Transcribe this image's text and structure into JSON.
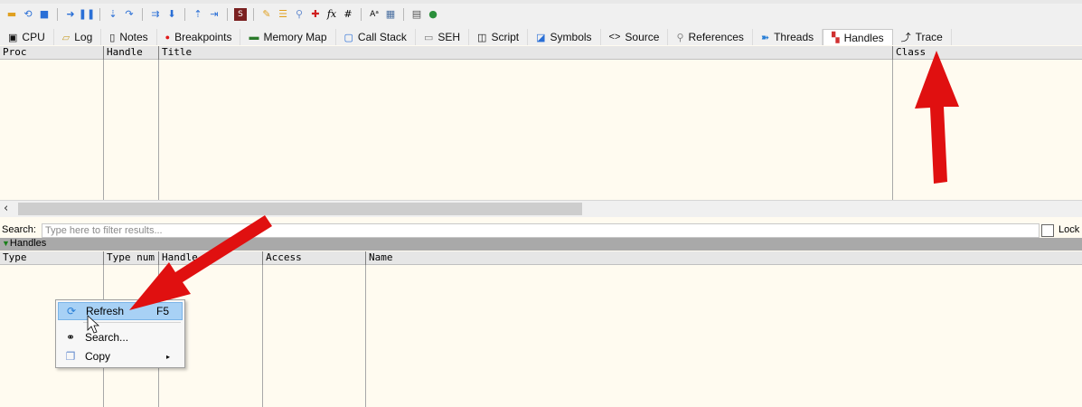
{
  "toolbar": {
    "icons": [
      "open-icon",
      "restart-icon",
      "stop-icon",
      "run-icon",
      "pause-icon",
      "step-into-icon",
      "step-over-icon",
      "trace-into-icon",
      "trace-over-icon",
      "execute-till-return-icon",
      "run-to-user-code-icon",
      "scylla-icon",
      "patch-icon",
      "comment-icon",
      "label-icon",
      "bookmark-icon",
      "function-icon",
      "hash-icon",
      "font-icon",
      "calculator-icon",
      "settings-icon",
      "globe-icon"
    ]
  },
  "tabs": [
    {
      "label": "CPU",
      "icon": "cpu-icon"
    },
    {
      "label": "Log",
      "icon": "log-icon"
    },
    {
      "label": "Notes",
      "icon": "notes-icon"
    },
    {
      "label": "Breakpoints",
      "icon": "breakpoint-dot-icon"
    },
    {
      "label": "Memory Map",
      "icon": "memory-map-icon"
    },
    {
      "label": "Call Stack",
      "icon": "call-stack-icon"
    },
    {
      "label": "SEH",
      "icon": "seh-icon"
    },
    {
      "label": "Script",
      "icon": "script-icon"
    },
    {
      "label": "Symbols",
      "icon": "symbols-icon"
    },
    {
      "label": "Source",
      "icon": "source-icon"
    },
    {
      "label": "References",
      "icon": "references-icon"
    },
    {
      "label": "Threads",
      "icon": "threads-icon"
    },
    {
      "label": "Handles",
      "icon": "handles-icon"
    },
    {
      "label": "Trace",
      "icon": "trace-icon"
    }
  ],
  "upper_table": {
    "columns": [
      "Proc",
      "Handle",
      "Title",
      "Class"
    ]
  },
  "search": {
    "label": "Search:",
    "placeholder": "Type here to filter results...",
    "lock_label": "Lock"
  },
  "group": {
    "label": "Handles"
  },
  "lower_table": {
    "columns": [
      "Type",
      "Type num",
      "Handle",
      "Access",
      "Name"
    ]
  },
  "context_menu": {
    "items": [
      {
        "label": "Refresh",
        "shortcut": "F5",
        "icon": "refresh-icon"
      },
      {
        "label": "Search...",
        "icon": "binoculars-icon"
      },
      {
        "label": "Copy",
        "icon": "copy-icon",
        "submenu": "▸"
      }
    ]
  },
  "colors": {
    "pane_bg": "#fffbf0",
    "annotation_arrow": "#e01010",
    "menu_highlight": "#a8d1f5"
  }
}
